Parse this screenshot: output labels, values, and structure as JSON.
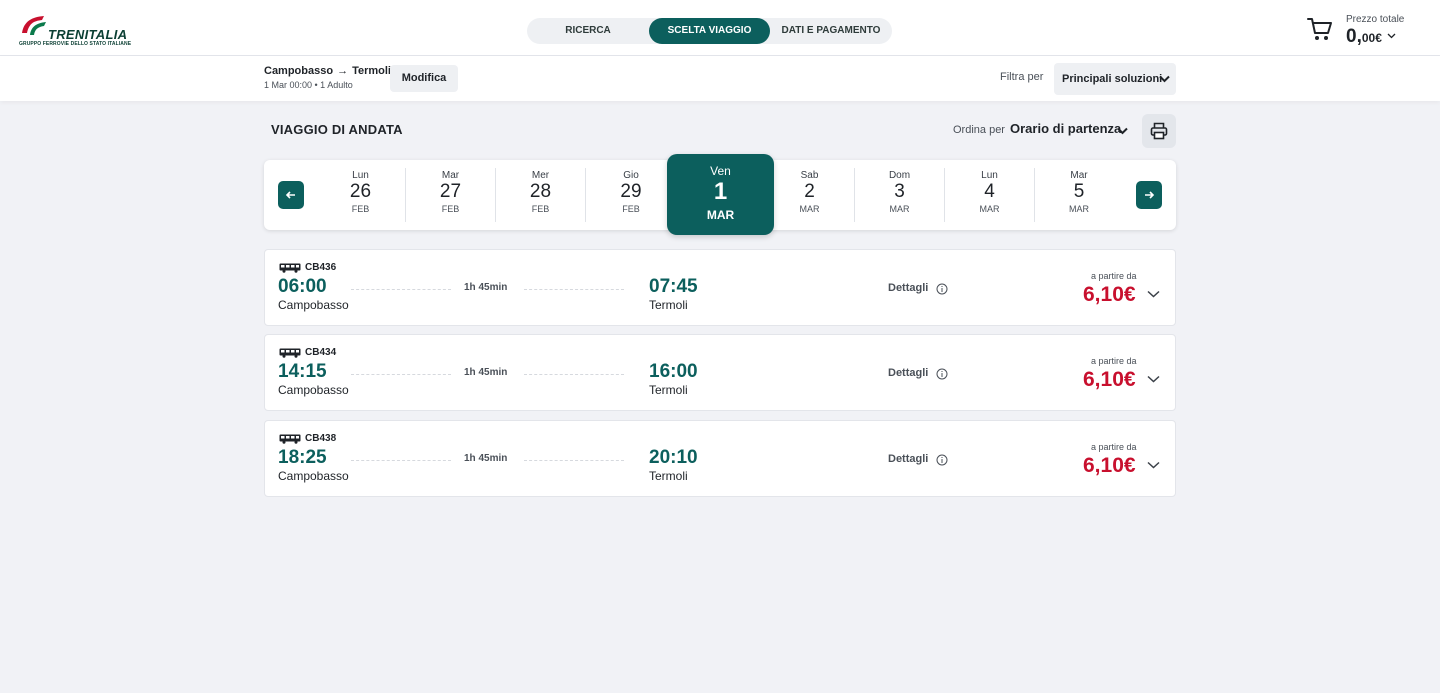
{
  "header": {
    "logo_text": "TRENITALIA",
    "logo_subtext": "GRUPPO FERROVIE DELLO STATO ITALIANE",
    "steps": [
      {
        "label": "RICERCA"
      },
      {
        "label": "SCELTA VIAGGIO"
      },
      {
        "label": "DATI E PAGAMENTO"
      }
    ],
    "active_step": 1,
    "cart": {
      "label": "Prezzo totale",
      "price_main": "0,",
      "price_decimals": "00€"
    }
  },
  "subheader": {
    "origin": "Campobasso",
    "destination": "Termoli",
    "arrow": "→",
    "details": "1 Mar 00:00 • 1 Adulto",
    "modify_label": "Modifica",
    "filter_label": "Filtra per",
    "filter_value": "Principali soluzioni"
  },
  "section": {
    "title": "VIAGGIO DI ANDATA",
    "sort_label": "Ordina per",
    "sort_value": "Orario di partenza"
  },
  "dates": [
    {
      "name": "Lun",
      "day": "26",
      "month": "FEB"
    },
    {
      "name": "Mar",
      "day": "27",
      "month": "FEB"
    },
    {
      "name": "Mer",
      "day": "28",
      "month": "FEB"
    },
    {
      "name": "Gio",
      "day": "29",
      "month": "FEB"
    },
    {
      "name": "Ven",
      "day": "1",
      "month": "MAR"
    },
    {
      "name": "Sab",
      "day": "2",
      "month": "MAR"
    },
    {
      "name": "Dom",
      "day": "3",
      "month": "MAR"
    },
    {
      "name": "Lun",
      "day": "4",
      "month": "MAR"
    },
    {
      "name": "Mar",
      "day": "5",
      "month": "MAR"
    }
  ],
  "solutions": [
    {
      "code": "CB436",
      "departure_time": "06:00",
      "departure_station": "Campobasso",
      "duration": "1h 45min",
      "arrival_time": "07:45",
      "arrival_station": "Termoli",
      "details_label": "Dettagli",
      "from_label": "a partire da",
      "price": "6,10€"
    },
    {
      "code": "CB434",
      "departure_time": "14:15",
      "departure_station": "Campobasso",
      "duration": "1h 45min",
      "arrival_time": "16:00",
      "arrival_station": "Termoli",
      "details_label": "Dettagli",
      "from_label": "a partire da",
      "price": "6,10€"
    },
    {
      "code": "CB438",
      "departure_time": "18:25",
      "departure_station": "Campobasso",
      "duration": "1h 45min",
      "arrival_time": "20:10",
      "arrival_station": "Termoli",
      "details_label": "Dettagli",
      "from_label": "a partire da",
      "price": "6,10€"
    }
  ],
  "colors": {
    "primary": "#0c5f5d",
    "price": "#c8102e",
    "background": "#f1f2f6"
  }
}
